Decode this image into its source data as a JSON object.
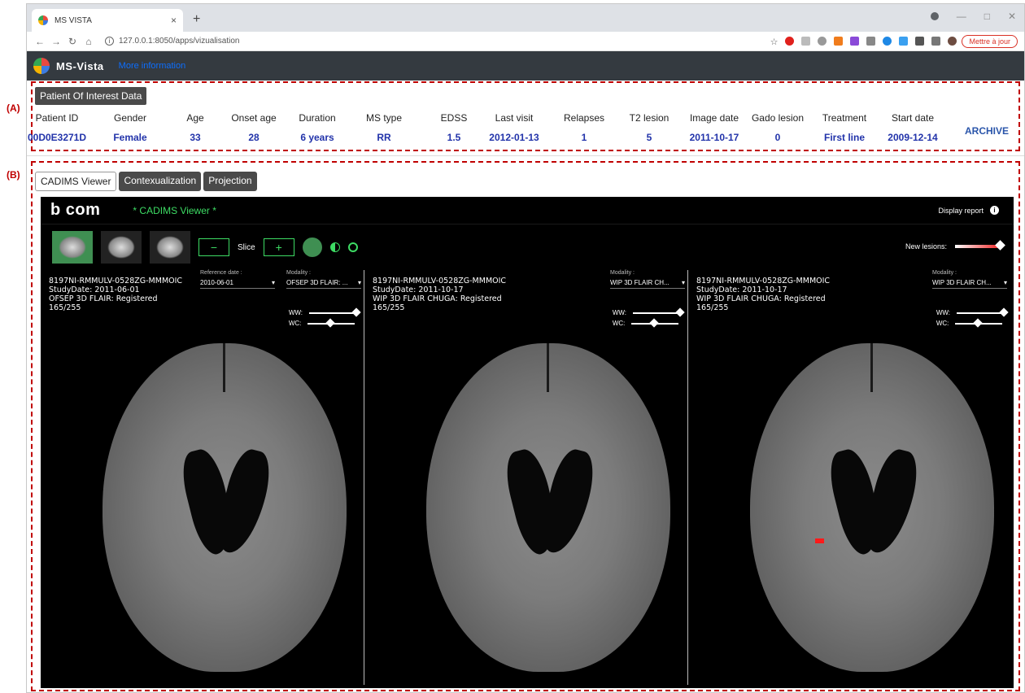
{
  "annotations": {
    "a": "(A)",
    "b": "(B)"
  },
  "browser": {
    "tab_title": "MS VISTA",
    "tab_close": "×",
    "new_tab": "+",
    "url": "127.0.0.1:8050/apps/vizualisation",
    "update_button": "Mettre à jour"
  },
  "app": {
    "name": "MS-Vista",
    "more_link": "More information"
  },
  "patient": {
    "panel_button": "Patient Of Interest Data",
    "columns": [
      {
        "h": "Patient ID",
        "v": "00D0E3271D"
      },
      {
        "h": "Gender",
        "v": "Female"
      },
      {
        "h": "Age",
        "v": "33"
      },
      {
        "h": "Onset age",
        "v": "28"
      },
      {
        "h": "Duration",
        "v": "6 years"
      },
      {
        "h": "MS type",
        "v": "RR"
      },
      {
        "h": "EDSS",
        "v": "1.5"
      },
      {
        "h": "Last visit",
        "v": "2012-01-13"
      },
      {
        "h": "Relapses",
        "v": "1"
      },
      {
        "h": "T2 lesion",
        "v": "5"
      },
      {
        "h": "Image date",
        "v": "2011-10-17"
      },
      {
        "h": "Gado lesion",
        "v": "0"
      },
      {
        "h": "Treatment",
        "v": "First line"
      },
      {
        "h": "Start date",
        "v": "2009-12-14"
      }
    ],
    "archive": "ARCHIVE"
  },
  "tabs": [
    "CADIMS Viewer",
    "Contexualization",
    "Projection"
  ],
  "viewer": {
    "brand": "b com",
    "title": "* CADIMS Viewer *",
    "display_report": "Display report",
    "info_icon": "i",
    "slice_label": "Slice",
    "minus": "−",
    "plus": "+",
    "new_lesions": "New lesions:",
    "panes": [
      {
        "lines": [
          "8197NI-RMMULV-0528ZG-MMMOIC",
          "StudyDate: 2011-06-01",
          "OFSEP 3D FLAIR: Registered",
          "165/255"
        ],
        "ref_label": "Reference date :",
        "ref_value": "2010-06-01",
        "mod_label": "Modality :",
        "mod_value": "OFSEP 3D FLAIR: ..."
      },
      {
        "lines": [
          "8197NI-RMMULV-0528ZG-MMMOIC",
          "StudyDate: 2011-10-17",
          "WIP 3D FLAIR CHUGA: Registered",
          "165/255"
        ],
        "mod_label": "Modality :",
        "mod_value": "WIP 3D FLAIR CH..."
      },
      {
        "lines": [
          "8197NI-RMMULV-0528ZG-MMMOIC",
          "StudyDate: 2011-10-17",
          "WIP 3D FLAIR CHUGA: Registered",
          "165/255"
        ],
        "mod_label": "Modality :",
        "mod_value": "WIP 3D FLAIR CH..."
      }
    ],
    "ww": "WW:",
    "wc": "WC:"
  }
}
